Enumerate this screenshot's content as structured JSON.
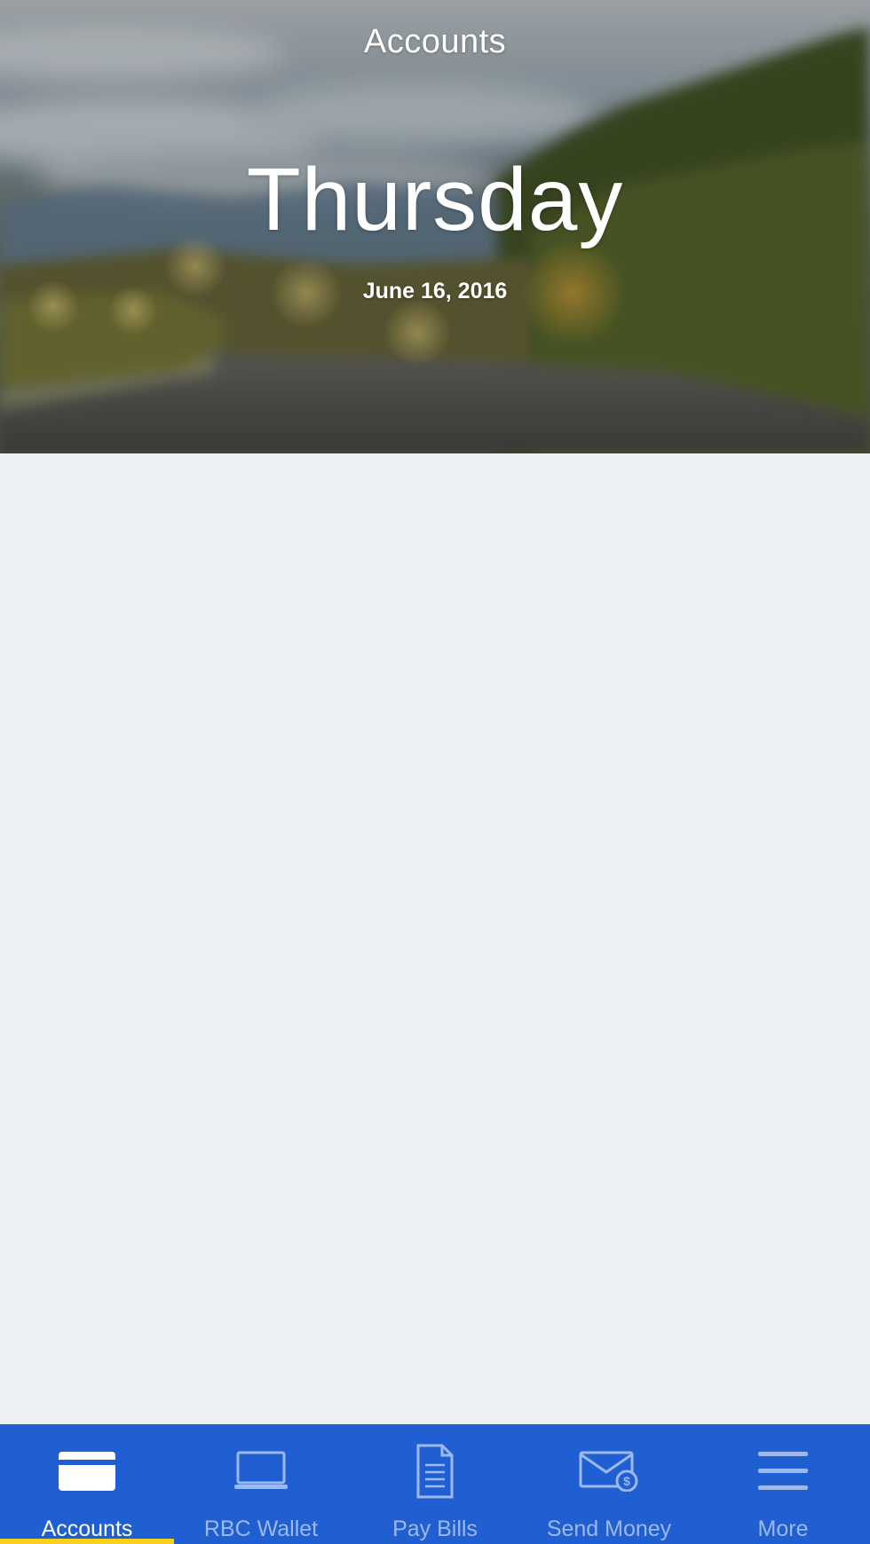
{
  "header": {
    "title": "Accounts",
    "day": "Thursday",
    "date": "June 16, 2016"
  },
  "tabbar": {
    "active_index": 0,
    "accent_color": "#1f5fd1",
    "active_underline_color": "#f5d11d",
    "items": [
      {
        "label": "Accounts",
        "icon": "card-icon"
      },
      {
        "label": "RBC Wallet",
        "icon": "laptop-icon"
      },
      {
        "label": "Pay Bills",
        "icon": "document-icon"
      },
      {
        "label": "Send Money",
        "icon": "envelope-money-icon"
      },
      {
        "label": "More",
        "icon": "hamburger-menu-icon"
      }
    ]
  }
}
